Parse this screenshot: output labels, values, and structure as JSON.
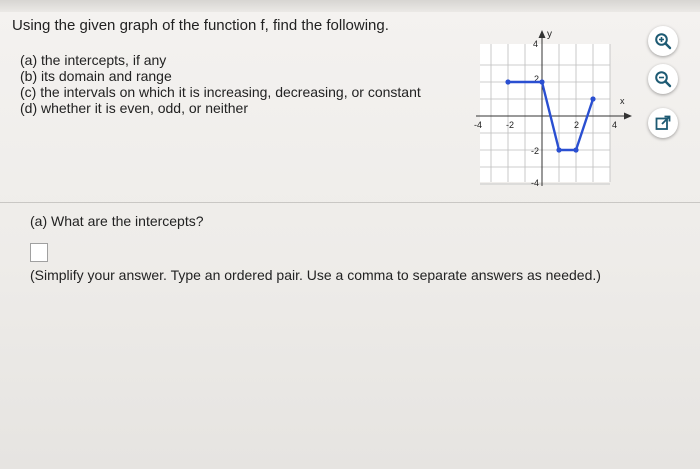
{
  "question": {
    "title": "Using the given graph of the function f, find the following.",
    "parts": [
      "(a) the intercepts, if any",
      "(b) its domain and range",
      "(c) the intervals on which it is increasing, decreasing, or constant",
      "(d) whether it is even, odd, or neither"
    ]
  },
  "graph": {
    "x_axis_label": "x",
    "y_axis_label": "y",
    "x_ticks": [
      "-4",
      "-2",
      "2",
      "4"
    ],
    "y_ticks": [
      "4",
      "2",
      "-2",
      "-4"
    ],
    "line_color": "#2a4fd1",
    "function_points": [
      [
        -2,
        2
      ],
      [
        0,
        2
      ],
      [
        1,
        -2
      ],
      [
        2,
        -2
      ],
      [
        3,
        1
      ]
    ],
    "xlim": [
      -4,
      4
    ],
    "ylim": [
      -4,
      4
    ]
  },
  "tools": [
    {
      "name": "zoom-in-icon"
    },
    {
      "name": "zoom-out-icon"
    },
    {
      "name": "pop-out-icon"
    }
  ],
  "subquestion": {
    "label": "(a) What are the intercepts?",
    "answer_value": "",
    "instruction": "(Simplify your answer. Type an ordered pair. Use a comma to separate answers as needed.)"
  }
}
